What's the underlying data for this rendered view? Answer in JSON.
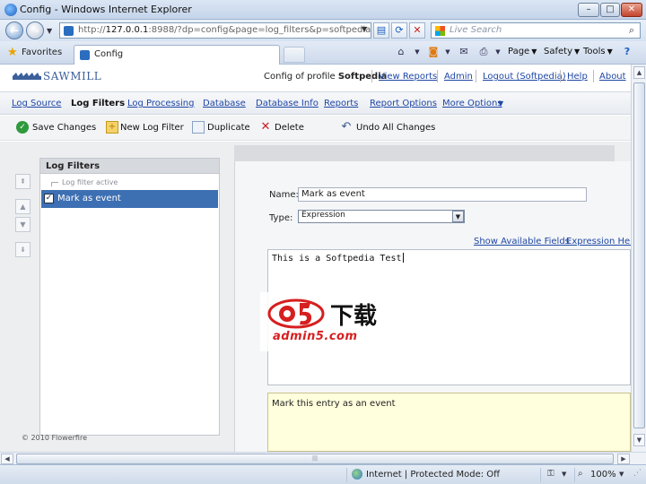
{
  "window": {
    "title": "Config - Windows Internet Explorer",
    "controls": {
      "minimize": "–",
      "maximize": "□",
      "close": "✕"
    }
  },
  "address_bar": {
    "url_prefix": "http://",
    "url_host": "127.0.0.1",
    "url_rest": ":8988/?dp=config&page=log_filters&p=softpedia",
    "search_placeholder": "Live Search"
  },
  "favorites_bar": {
    "favorites_label": "Favorites",
    "tab_title": "Config",
    "commands": {
      "page": "Page",
      "safety": "Safety",
      "tools": "Tools"
    }
  },
  "app": {
    "logo_text": "SAWMILL",
    "profile_prefix": "Config of profile",
    "profile_name": "Softpedia",
    "top_links": [
      "View Reports",
      "Admin",
      "Logout (Softpedia)",
      "Help",
      "About"
    ],
    "nav_items": [
      "Log Source",
      "Log Filters",
      "Log Processing",
      "Database",
      "Database Info",
      "Reports",
      "Report Options",
      "More Options"
    ],
    "active_nav": "Log Filters",
    "actions": {
      "save": "Save Changes",
      "new_filter": "New Log Filter",
      "duplicate": "Duplicate",
      "delete": "Delete",
      "undo": "Undo All Changes"
    }
  },
  "filters_panel": {
    "header": "Log Filters",
    "hint": "Log filter active",
    "items": [
      {
        "label": "Mark as event",
        "checked": true,
        "selected": true
      }
    ]
  },
  "editor": {
    "name_label": "Name:",
    "name_value": "Mark as event",
    "type_label": "Type:",
    "type_value": "Expression",
    "link_fields": "Show Available Fields",
    "link_help": "Expression Help",
    "expression": "This is a Softpedia Test",
    "description": "Mark this entry as an event"
  },
  "footer": {
    "copyright": "© 2010 Flowerfire"
  },
  "watermark": {
    "cn_text": "下载",
    "url_text": "admin5.com"
  },
  "status_bar": {
    "zone": "Internet | Protected Mode: Off",
    "zoom": "100%"
  },
  "colors": {
    "selection": "#3d6fb3",
    "link": "#1f47a6",
    "description_bg": "#ffffdd"
  }
}
